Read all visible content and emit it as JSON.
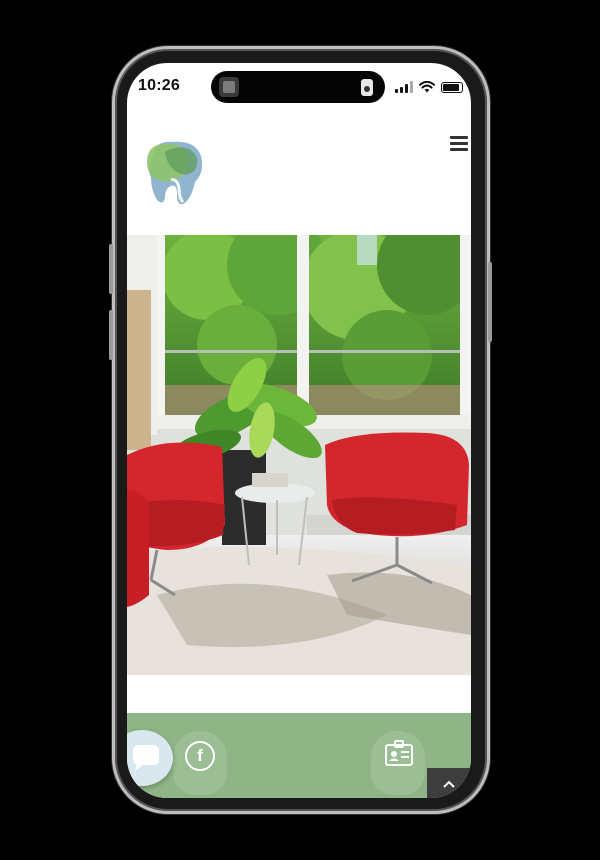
{
  "status_bar": {
    "time": "10:26"
  },
  "header": {
    "logo_icon": "tooth-logo",
    "menu_icon": "hamburger-menu-icon"
  },
  "hero": {
    "image_subject": "waiting-room-photo"
  },
  "footer": {
    "chat_icon": "chat-bubble-icon",
    "facebook_label": "f",
    "contact_icon": "id-card-icon",
    "scroll_top_label": "^"
  },
  "colors": {
    "footer_green": "#8fb586",
    "logo_green": "#8ec36a",
    "logo_blue": "#7fa8c7",
    "chair_red": "#d4262d"
  }
}
